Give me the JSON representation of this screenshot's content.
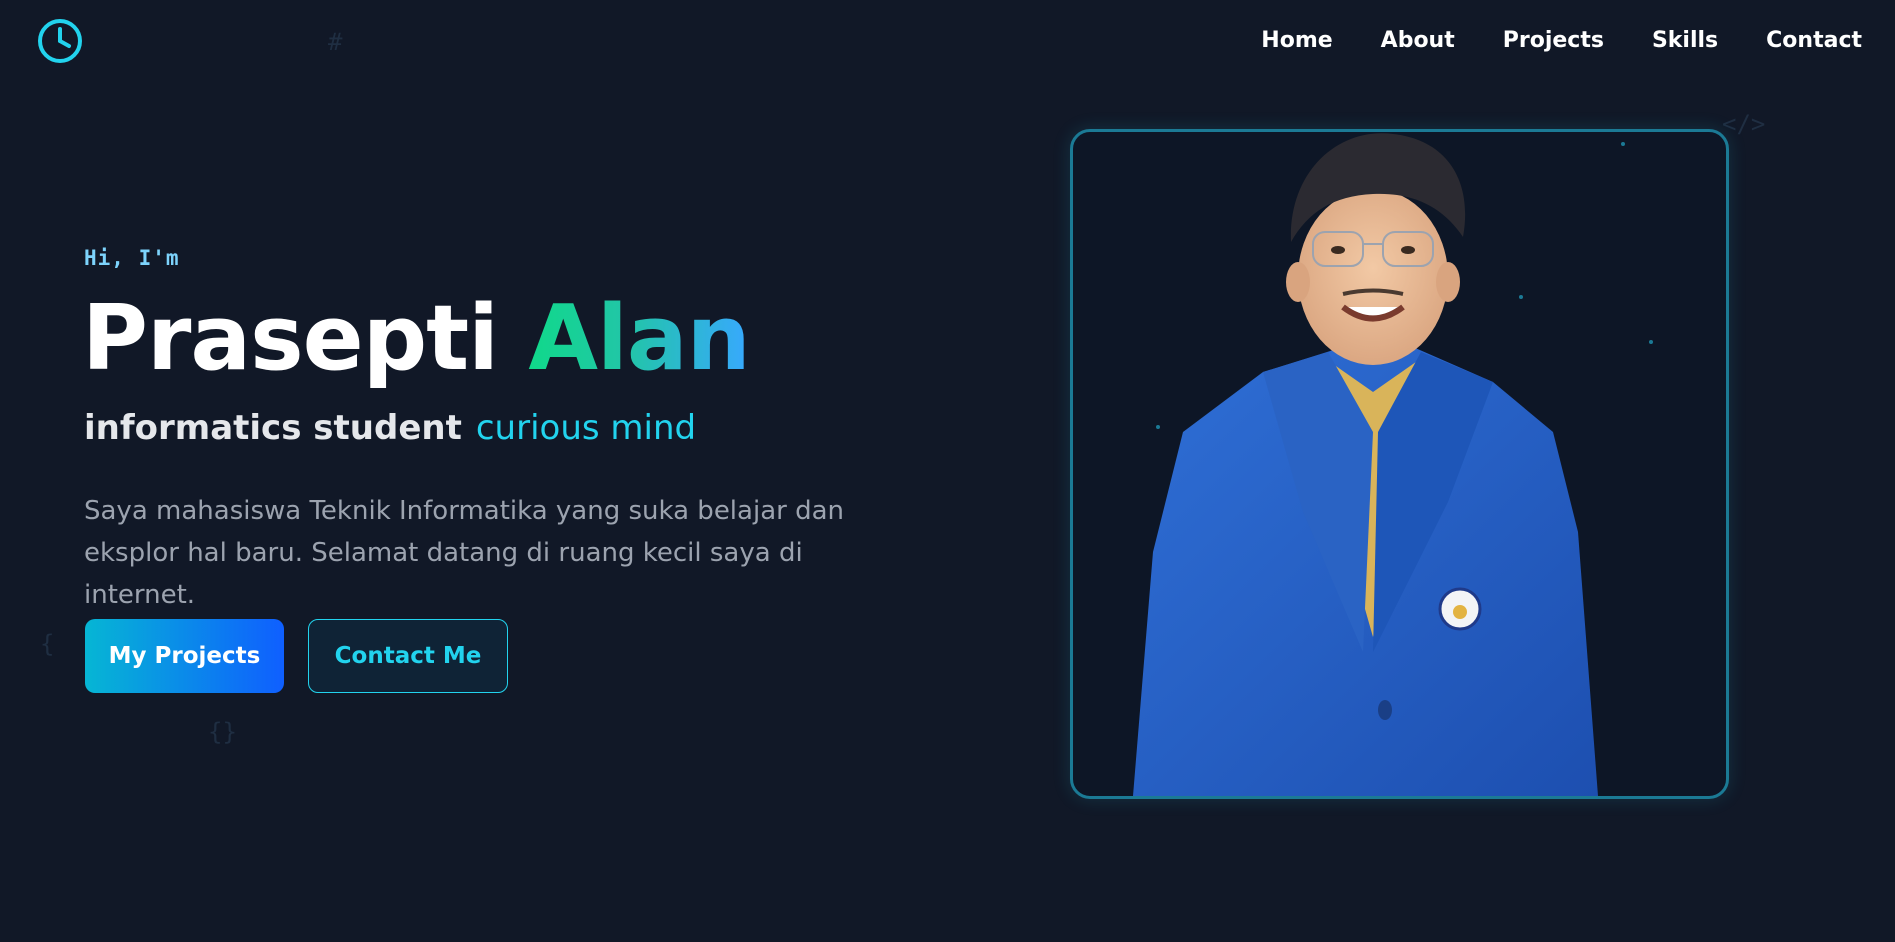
{
  "nav": {
    "logo_icon": "clock-icon",
    "links": [
      "Home",
      "About",
      "Projects",
      "Skills",
      "Contact"
    ]
  },
  "hero": {
    "greeting": "Hi, I'm",
    "first_name": "Prasepti",
    "last_name": "Alan",
    "role": "informatics student",
    "trait": "curious mind",
    "description_line1": "Saya mahasiswa Teknik Informatika yang suka belajar dan",
    "description_line2": "eksplor hal baru. Selamat datang di ruang kecil saya di internet.",
    "primary_button": "My Projects",
    "secondary_button": "Contact Me"
  },
  "decor": {
    "hash": "#",
    "code_tag": "</>",
    "braces": "{}",
    "brace_left": "{ "
  },
  "colors": {
    "background": "#111827",
    "accent": "#22d3ee",
    "gradient_start": "#10d98a",
    "gradient_end": "#38a8ff",
    "button_gradient_start": "#06b6d4",
    "button_gradient_end": "#0f5fff"
  }
}
